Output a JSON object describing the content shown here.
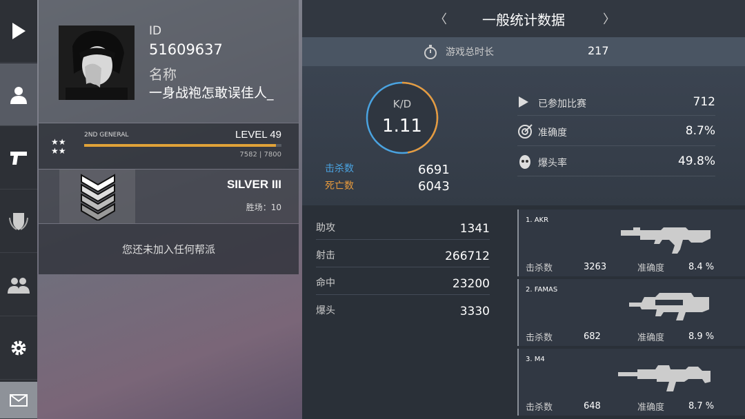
{
  "sidebar": {
    "items": [
      {
        "name": "play",
        "icon": "play-icon"
      },
      {
        "name": "profile",
        "icon": "person-icon"
      },
      {
        "name": "weapons",
        "icon": "pistol-icon"
      },
      {
        "name": "ranks",
        "icon": "emblem-icon"
      },
      {
        "name": "friends",
        "icon": "group-icon"
      },
      {
        "name": "settings",
        "icon": "gear-icon"
      },
      {
        "name": "mail",
        "icon": "mail-icon"
      }
    ]
  },
  "profile": {
    "id_label": "ID",
    "id_value": "51609637",
    "name_label": "名称",
    "name_value": "一身战袍怎敢误佳人_",
    "rank_title": "2ND GENERAL",
    "level_text": "LEVEL 49",
    "xp_text": "7582 | 7800",
    "xp_progress": 0.972,
    "league": "SILVER III",
    "wins_text": "胜场：10",
    "clan_text": "您还未加入任何帮派"
  },
  "stats": {
    "title": "一般统计数据",
    "prev_arrow": "〈",
    "next_arrow": "〉",
    "playtime_label": "游戏总时长",
    "playtime_value": "217",
    "kd_label": "K/D",
    "kd_value": "1.11",
    "kd_ratio": 0.525,
    "kills_label": "击杀数",
    "kills_value": "6691",
    "deaths_label": "死亡数",
    "deaths_value": "6043",
    "matches_label": "已参加比赛",
    "matches_value": "712",
    "accuracy_label": "准确度",
    "accuracy_value": "8.7%",
    "headshot_rate_label": "爆头率",
    "headshot_rate_value": "49.8%",
    "assists_label": "助攻",
    "assists_value": "1341",
    "shots_label": "射击",
    "shots_value": "266712",
    "hits_label": "命中",
    "hits_value": "23200",
    "headshots_label": "爆头",
    "headshots_value": "3330"
  },
  "weapons": [
    {
      "name": "1. AKR",
      "kills_label": "击杀数",
      "kills": "3263",
      "acc_label": "准确度",
      "acc": "8.4 %"
    },
    {
      "name": "2. FAMAS",
      "kills_label": "击杀数",
      "kills": "682",
      "acc_label": "准确度",
      "acc": "8.9 %"
    },
    {
      "name": "3. M4",
      "kills_label": "击杀数",
      "kills": "648",
      "acc_label": "准确度",
      "acc": "8.7 %"
    }
  ],
  "colors": {
    "kills": "#4aa3e0",
    "deaths": "#e89a3c",
    "xp_bar": "#e0a238"
  }
}
